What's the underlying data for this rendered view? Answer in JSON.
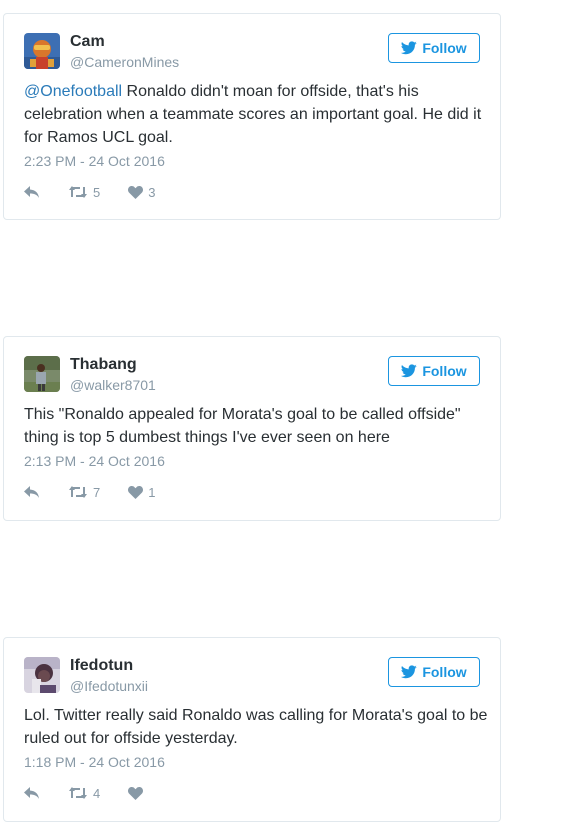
{
  "follow_label": "Follow",
  "colors": {
    "twitter_blue": "#1b95e0",
    "mention": "#2b7bb9",
    "muted": "#8899a6",
    "border": "#e1e8ed"
  },
  "icons": [
    "twitter-bird-icon",
    "reply-icon",
    "retweet-icon",
    "heart-icon"
  ],
  "tweets": [
    {
      "display_name": "Cam",
      "screen_name": "@CameronMines",
      "mention": "@Onefootball",
      "text": " Ronaldo didn't moan for offside, that's his celebration when a teammate scores an important goal. He did it for Ramos UCL goal.",
      "timestamp": "2:23 PM - 24 Oct 2016",
      "retweets": "5",
      "likes": "3"
    },
    {
      "display_name": "Thabang",
      "screen_name": "@walker8701",
      "text": "This \"Ronaldo appealed for Morata's goal to be called offside\" thing is top 5 dumbest things I've ever seen on here",
      "timestamp": "2:13 PM - 24 Oct 2016",
      "retweets": "7",
      "likes": "1"
    },
    {
      "display_name": "Ifedotun",
      "screen_name": "@Ifedotunxii",
      "text": "Lol. Twitter really said Ronaldo was calling for Morata's goal to be ruled out for offside yesterday.",
      "timestamp": "1:18 PM - 24 Oct 2016",
      "retweets": "4",
      "likes": ""
    }
  ]
}
